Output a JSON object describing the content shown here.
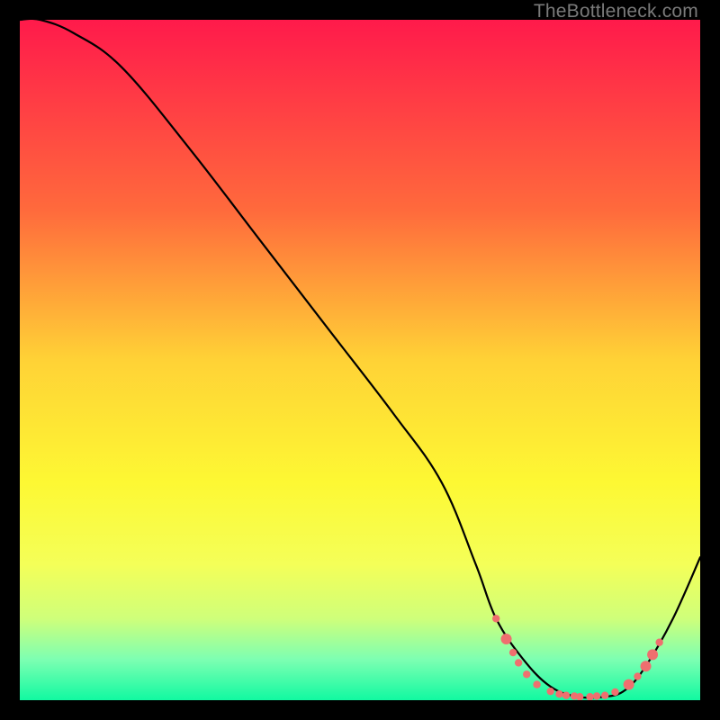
{
  "watermark": "TheBottleneck.com",
  "chart_data": {
    "type": "line",
    "title": "",
    "xlabel": "",
    "ylabel": "",
    "xlim": [
      0,
      100
    ],
    "ylim": [
      0,
      100
    ],
    "grid": false,
    "legend": false,
    "gradient_stops": [
      {
        "offset": 0,
        "color": "#ff1a4b"
      },
      {
        "offset": 28,
        "color": "#ff6a3c"
      },
      {
        "offset": 50,
        "color": "#ffd236"
      },
      {
        "offset": 68,
        "color": "#fdf833"
      },
      {
        "offset": 80,
        "color": "#f4ff58"
      },
      {
        "offset": 88,
        "color": "#cfff7a"
      },
      {
        "offset": 94,
        "color": "#7dffb2"
      },
      {
        "offset": 100,
        "color": "#11f9a1"
      }
    ],
    "series": [
      {
        "name": "bottleneck-curve",
        "x": [
          0,
          3,
          8,
          15,
          25,
          35,
          45,
          55,
          62,
          67,
          70,
          74,
          78,
          82,
          86,
          89,
          92,
          96,
          100
        ],
        "y": [
          100,
          100,
          98,
          93,
          81,
          68,
          55,
          42,
          32,
          20,
          12,
          6,
          2,
          0.5,
          0.5,
          1.5,
          5,
          12,
          21
        ]
      }
    ],
    "markers": {
      "name": "highlight-points",
      "color": "#ef6f6f",
      "radius_small": 4.2,
      "radius_large": 6.0,
      "points": [
        {
          "x": 70.0,
          "y": 12.0,
          "r": "small"
        },
        {
          "x": 71.5,
          "y": 9.0,
          "r": "large"
        },
        {
          "x": 72.5,
          "y": 7.0,
          "r": "small"
        },
        {
          "x": 73.3,
          "y": 5.5,
          "r": "small"
        },
        {
          "x": 74.5,
          "y": 3.8,
          "r": "small"
        },
        {
          "x": 76.0,
          "y": 2.3,
          "r": "small"
        },
        {
          "x": 78.0,
          "y": 1.3,
          "r": "small"
        },
        {
          "x": 79.3,
          "y": 0.9,
          "r": "small"
        },
        {
          "x": 80.3,
          "y": 0.7,
          "r": "small"
        },
        {
          "x": 81.5,
          "y": 0.6,
          "r": "small"
        },
        {
          "x": 82.3,
          "y": 0.5,
          "r": "small"
        },
        {
          "x": 83.8,
          "y": 0.5,
          "r": "small"
        },
        {
          "x": 84.8,
          "y": 0.6,
          "r": "small"
        },
        {
          "x": 86.0,
          "y": 0.7,
          "r": "small"
        },
        {
          "x": 87.5,
          "y": 1.2,
          "r": "small"
        },
        {
          "x": 89.5,
          "y": 2.3,
          "r": "large"
        },
        {
          "x": 90.8,
          "y": 3.5,
          "r": "small"
        },
        {
          "x": 92.0,
          "y": 5.0,
          "r": "large"
        },
        {
          "x": 93.0,
          "y": 6.7,
          "r": "large"
        },
        {
          "x": 94.0,
          "y": 8.5,
          "r": "small"
        }
      ]
    }
  }
}
